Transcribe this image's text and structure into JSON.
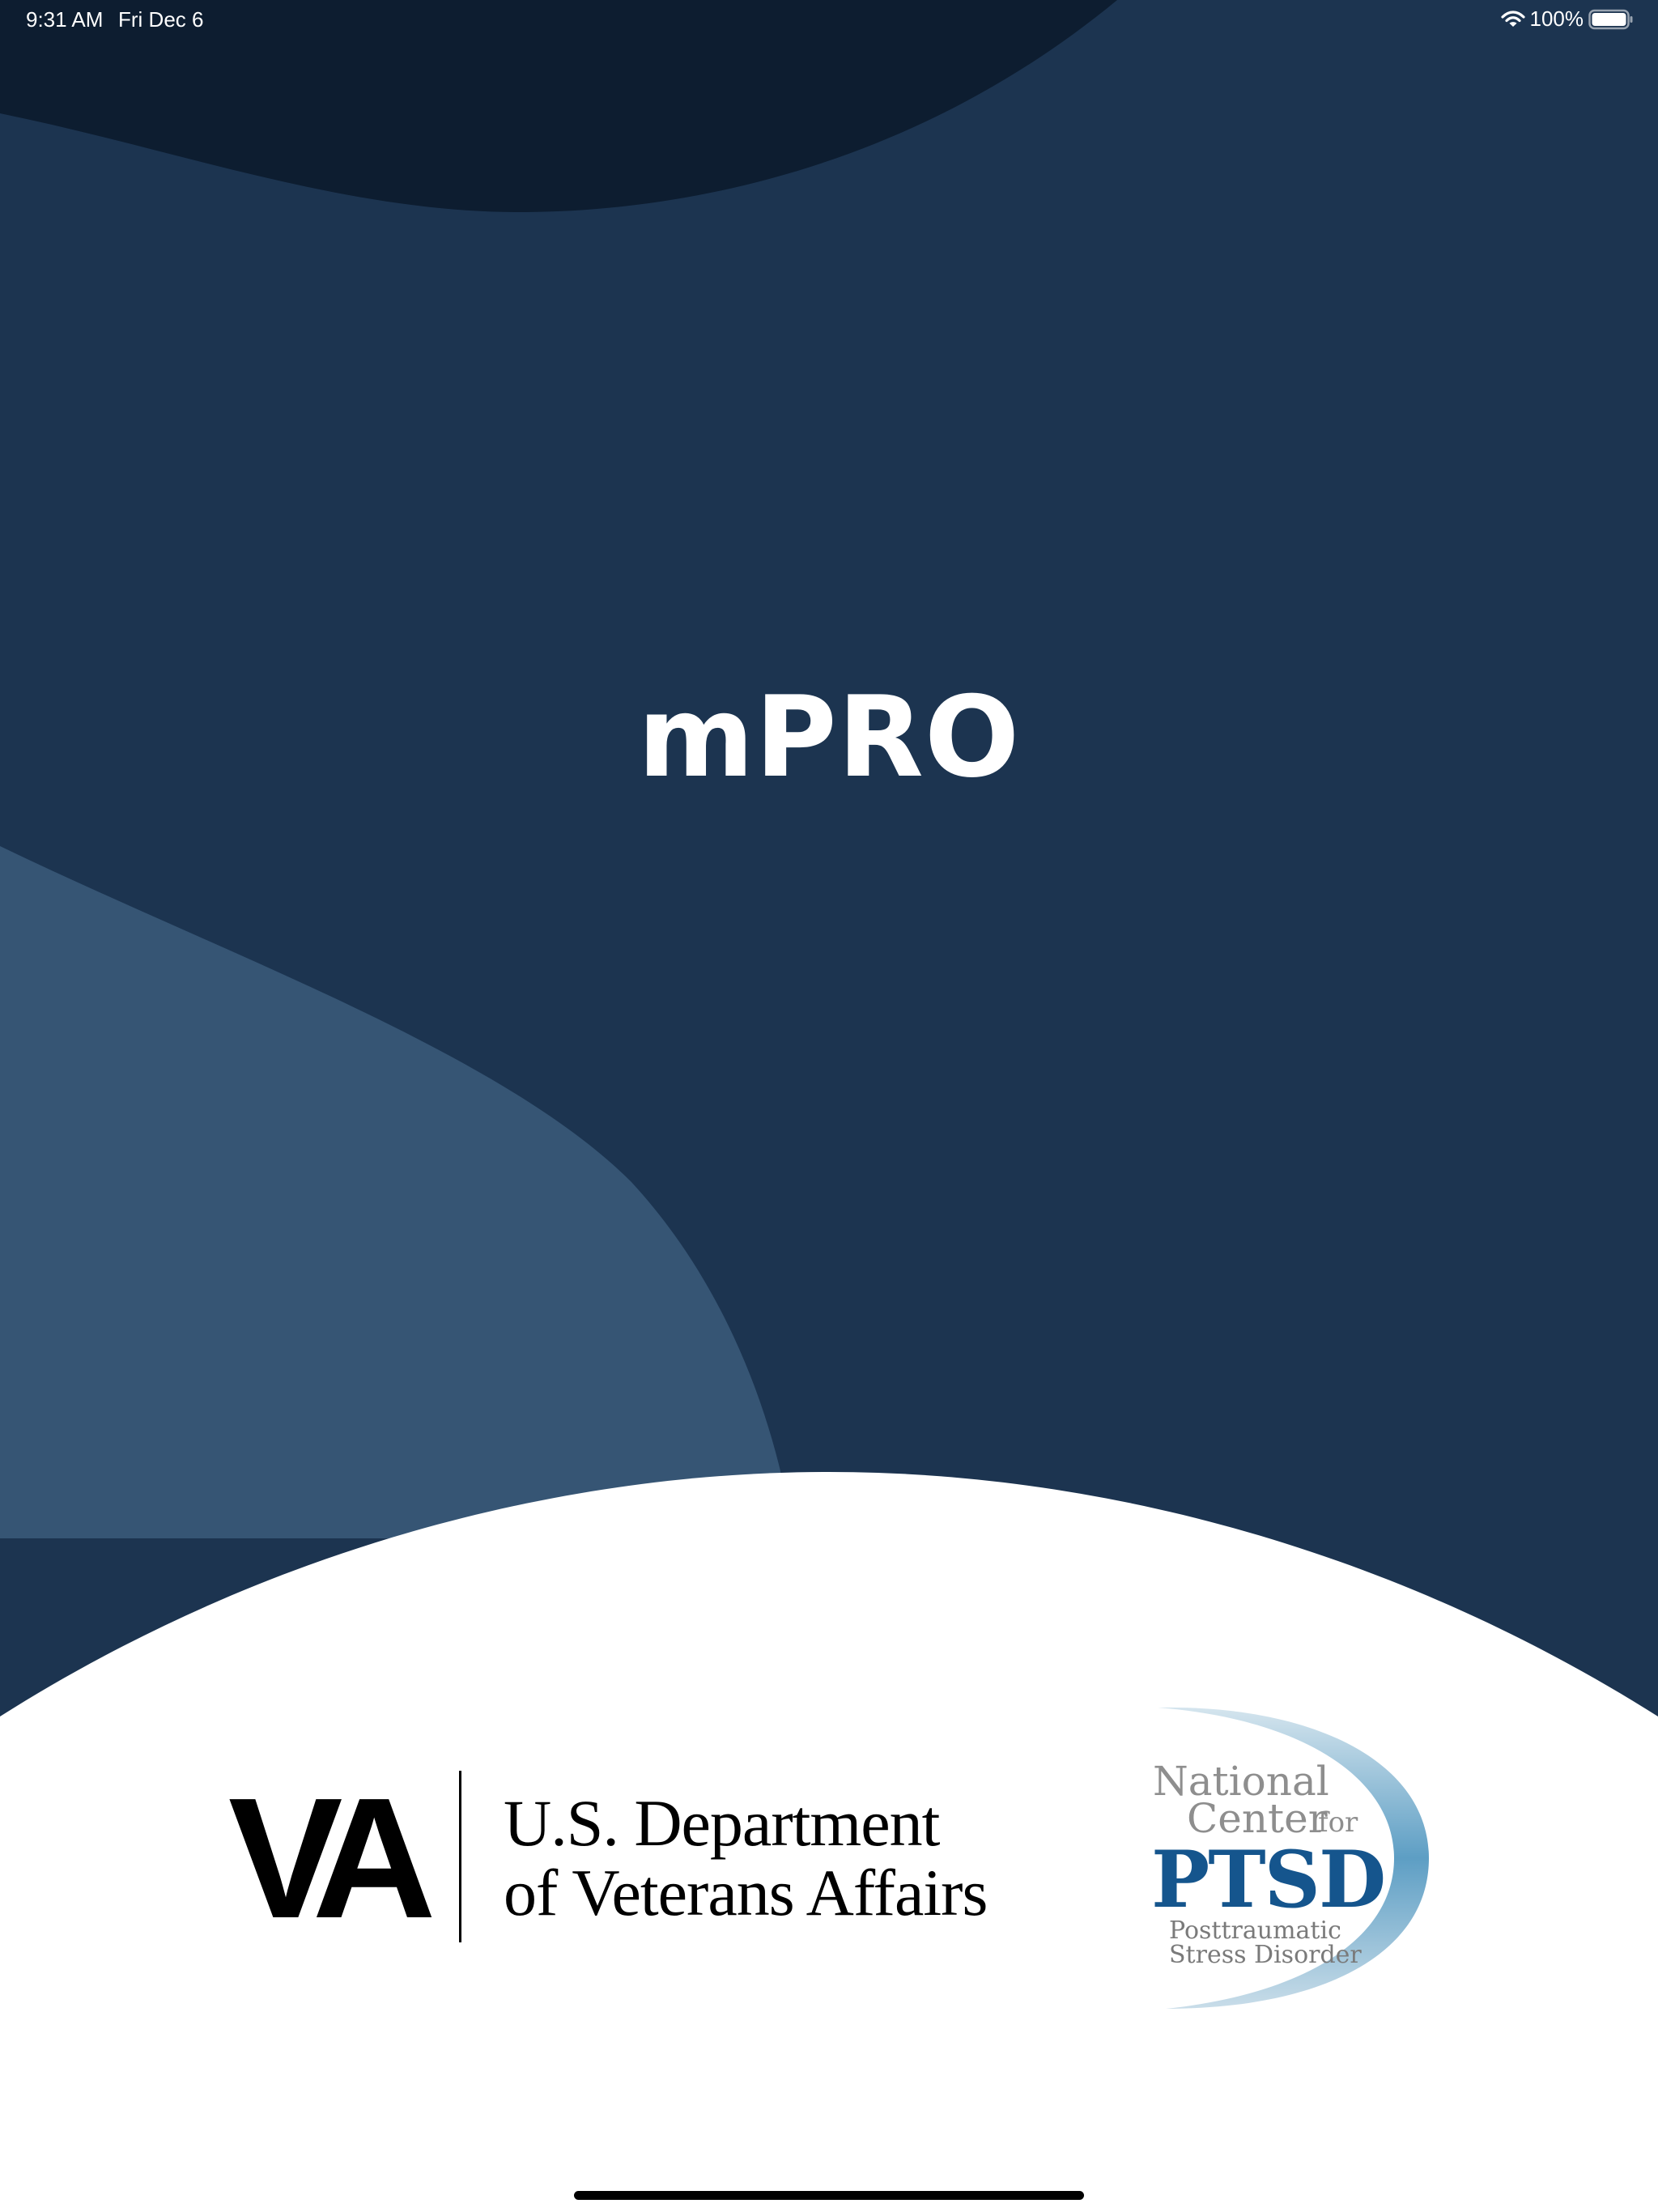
{
  "status_bar": {
    "time": "9:31 AM",
    "date": "Fri Dec 6",
    "battery": "100%",
    "battery_level": 1.0
  },
  "app": {
    "title": "mPRO"
  },
  "footer": {
    "va_logo": {
      "mark": "VA",
      "line1": "U.S. Department",
      "line2": "of Veterans Affairs"
    },
    "ptsd_logo": {
      "line1": "National",
      "line2": "Center",
      "line2_suffix": "for",
      "acronym": "PTSD",
      "line3": "Posttraumatic",
      "line4": "Stress Disorder"
    }
  },
  "colors": {
    "navy": "#1c3450",
    "dark_navy": "#0d1d30",
    "slate_blue": "#365574",
    "ptsd_blue": "#15558d",
    "white": "#ffffff"
  }
}
